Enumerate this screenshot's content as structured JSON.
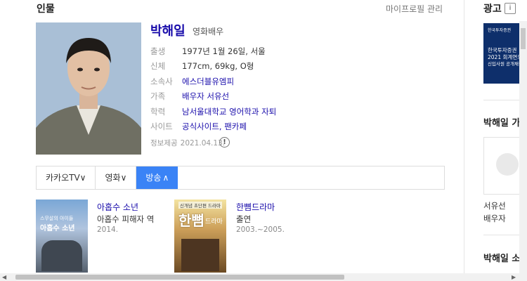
{
  "section": {
    "title": "인물",
    "profile_link": "마이프로필 관리"
  },
  "person": {
    "name": "박해일",
    "role": "영화배우",
    "info": [
      {
        "label": "출생",
        "value": "1977년 1월 26일, 서울",
        "link": false
      },
      {
        "label": "신체",
        "value": "177cm, 69kg, O형",
        "link": false
      },
      {
        "label": "소속사",
        "value": "에스더블유엠피",
        "link": true
      },
      {
        "label": "가족",
        "value": "배우자 서유선",
        "link": true
      },
      {
        "label": "학력",
        "value": "남서울대학교 영어학과 자퇴",
        "link": true
      },
      {
        "label": "사이트",
        "value": "공식사이트, 팬카페",
        "link": true
      }
    ],
    "source_label": "정보제공",
    "source_date": "2021.04.13.",
    "info_icon": "!"
  },
  "tabs": [
    {
      "label": "카카오TV",
      "suffix": "∨",
      "active": false
    },
    {
      "label": "영화",
      "suffix": "∨",
      "active": false
    },
    {
      "label": "방송",
      "suffix": "∧",
      "active": true
    }
  ],
  "works": [
    {
      "title": "아홉수 소년",
      "sub": "아홉수 피해자 역",
      "year": "2014."
    },
    {
      "title": "한뼘드라마",
      "sub": "출연",
      "year": "2003.~2005."
    }
  ],
  "thumb_text": {
    "w1_top": "스무살의 아이들",
    "w1_big": "아홉수 소년",
    "w2_top": "신개념 초단편 드라마",
    "w2_big": "한뼘",
    "w2_small": "드라마"
  },
  "sidebar": {
    "ad_label": "광고",
    "ad_icon": "i",
    "ad_banner_lines": [
      "한국투자증권",
      "한국투자증권",
      "2021 회계연도",
      "신입사원 공개채용"
    ],
    "related_heading": "박해일 가",
    "related_name": "서유선",
    "related_role": "배우자",
    "bottom_heading": "박해일 소"
  },
  "colors": {
    "accent": "#3a83f6",
    "link": "#1a0dab",
    "ad_bg": "#0e2f6b"
  }
}
